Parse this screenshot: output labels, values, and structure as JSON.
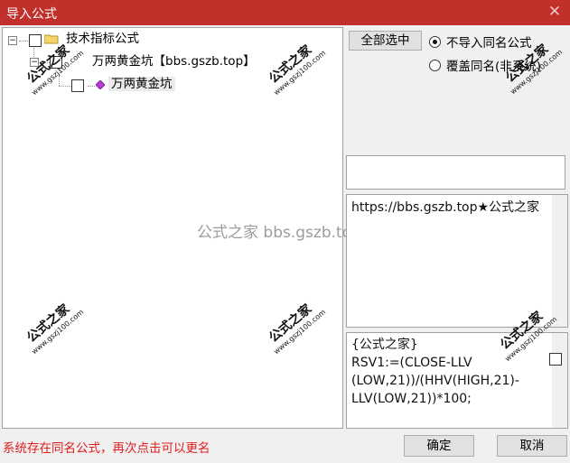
{
  "window": {
    "title": "导入公式",
    "close_glyph": "✕"
  },
  "tree": {
    "root": {
      "label": "技术指标公式",
      "expander": "−"
    },
    "child": {
      "label": "万两黄金坑【bbs.gszb.top】",
      "expander": "−"
    },
    "leaf": {
      "label": "万两黄金坑"
    }
  },
  "watermark_center": "公式之家 bbs.gszb.top",
  "watermark_stamp": {
    "big": "公式之家",
    "small": "www.gszj100.com"
  },
  "buttons": {
    "select_all": "全部选中",
    "ok": "确定",
    "cancel": "取消"
  },
  "options": {
    "no_import_same": "不导入同名公式",
    "overwrite_same": "覆盖同名(非系统)",
    "selected": "no_import_same"
  },
  "info_box": {
    "text": "https://bbs.gszb.top★公式之家"
  },
  "formula_box": {
    "lines": [
      "{公式之家}",
      "RSV1:=(CLOSE-LLV",
      "(LOW,21))/(HHV(HIGH,21)-",
      "LLV(LOW,21))*100;"
    ]
  },
  "status": "系统存在同名公式，再次点击可以更名",
  "colors": {
    "title_bar": "#c2302b",
    "status_text": "#e02020"
  }
}
